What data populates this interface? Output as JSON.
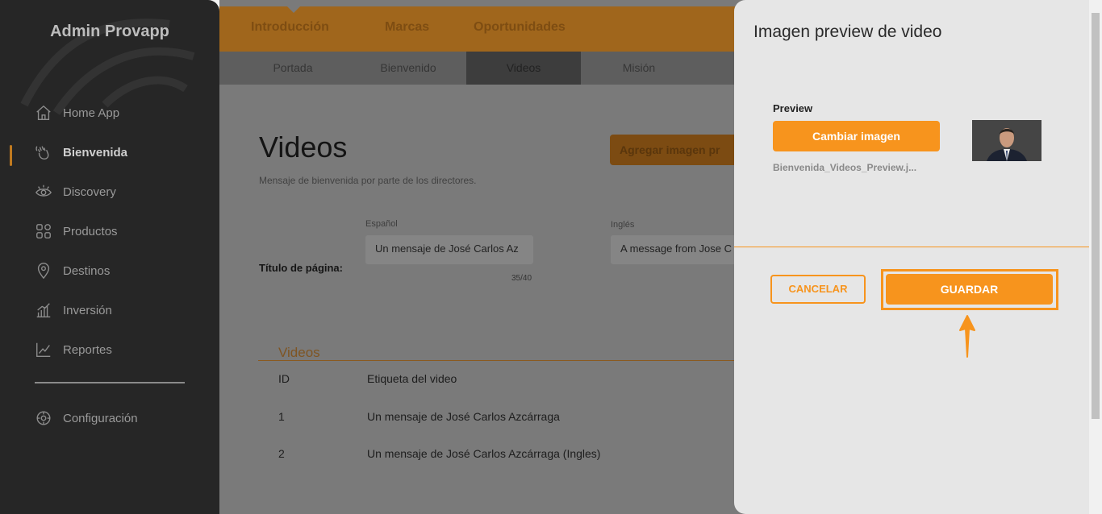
{
  "sidebar": {
    "brand": "Admin Provapp",
    "items": [
      {
        "label": "Home App",
        "icon": "home-icon"
      },
      {
        "label": "Bienvenida",
        "icon": "wave-hand-icon",
        "active": true
      },
      {
        "label": "Discovery",
        "icon": "eye-icon"
      },
      {
        "label": "Productos",
        "icon": "grid-icon"
      },
      {
        "label": "Destinos",
        "icon": "map-pin-icon"
      },
      {
        "label": "Inversión",
        "icon": "bar-chart-icon"
      },
      {
        "label": "Reportes",
        "icon": "trend-chart-icon"
      }
    ],
    "settings": {
      "label": "Configuración",
      "icon": "gear-icon"
    }
  },
  "topnav": {
    "tabs": [
      "Introducción",
      "Marcas",
      "Oportunidades"
    ],
    "subtabs": [
      "Portada",
      "Bienvenido",
      "Videos",
      "Misión"
    ],
    "active_subtab": "Videos"
  },
  "content": {
    "title": "Videos",
    "subtitle": "Mensaje de bienvenida por parte de los directores.",
    "add_button": "Agregar imagen pr",
    "page_title_label": "Título de página:",
    "spanish_label": "Español",
    "english_label": "Inglés",
    "spanish_value": "Un mensaje de José Carlos Az",
    "english_value": "A message from Jose C",
    "counter": "35/40",
    "section_title": "Videos",
    "table": {
      "headers": [
        "ID",
        "Etiqueta del video"
      ],
      "rows": [
        [
          "1",
          "Un mensaje de José Carlos Azcárraga"
        ],
        [
          "2",
          "Un mensaje de José Carlos Azcárraga (Ingles)"
        ]
      ]
    }
  },
  "panel": {
    "title": "Imagen preview de video",
    "preview_label": "Preview",
    "change_button": "Cambiar imagen",
    "file_name": "Bienvenida_Videos_Preview.j...",
    "cancel_button": "CANCELAR",
    "save_button": "GUARDAR"
  },
  "colors": {
    "accent": "#f7941d",
    "sidebar_bg": "#262626",
    "panel_bg": "#e6e6e6"
  }
}
